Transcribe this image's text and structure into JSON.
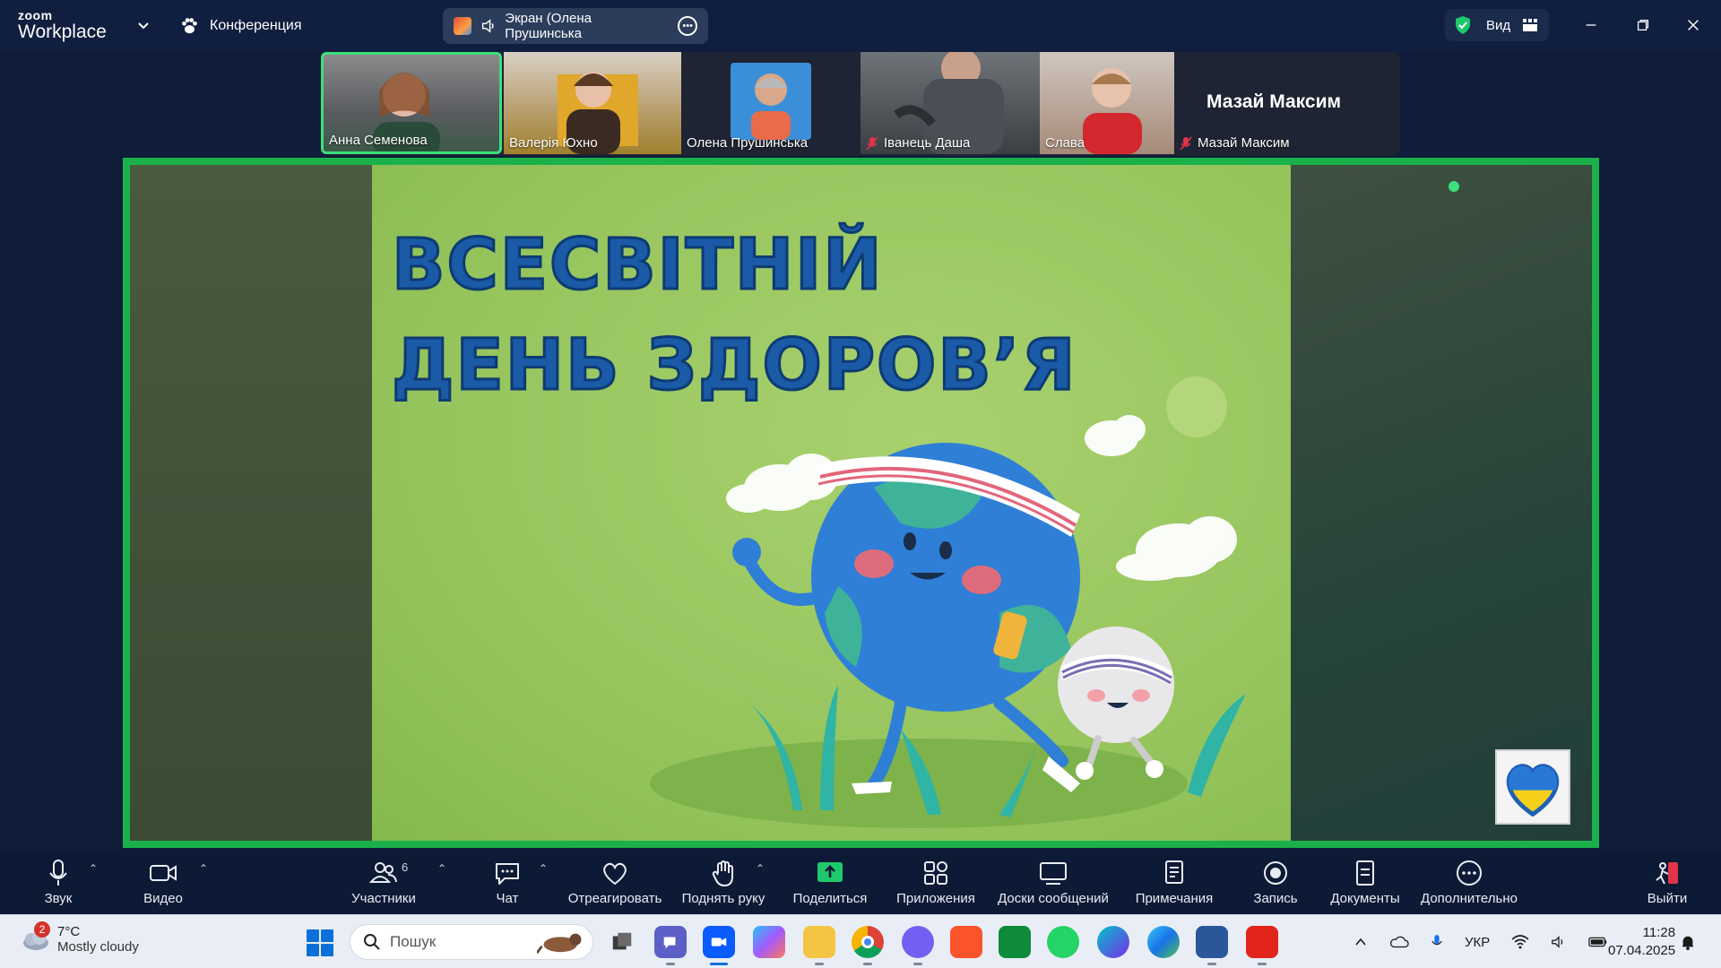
{
  "titlebar": {
    "logo_line1": "zoom",
    "logo_line2": "Workplace",
    "meeting_label": "Конференция",
    "share_label": "Экран (Олена Прушинська",
    "view_label": "Вид"
  },
  "participants": [
    {
      "name": "Анна Семенова",
      "muted": false,
      "active": true
    },
    {
      "name": "Валерія Юхно",
      "muted": false,
      "active": false
    },
    {
      "name": "Олена Прушинська",
      "muted": false,
      "active": false
    },
    {
      "name": "Іванець Даша",
      "muted": true,
      "active": false
    },
    {
      "name": "Слава",
      "muted": false,
      "active": false
    },
    {
      "name": "Мазай Максим",
      "muted": true,
      "active": false,
      "avatar_text": "Мазай Максим"
    }
  ],
  "slide": {
    "title_line1": "ВСЕСВІТНІЙ",
    "title_line2": "ДЕНЬ ЗДОРОВ’Я"
  },
  "toolbar": {
    "audio": "Звук",
    "video": "Видео",
    "participants": "Участники",
    "participants_count": "6",
    "chat": "Чат",
    "react": "Отреагировать",
    "raise_hand": "Поднять руку",
    "share": "Поделиться",
    "apps": "Приложения",
    "whiteboards": "Доски сообщений",
    "notes": "Примечания",
    "record": "Запись",
    "docs": "Документы",
    "more": "Дополнительно",
    "leave": "Выйти"
  },
  "taskbar": {
    "weather_badge": "2",
    "temperature": "7°C",
    "condition": "Mostly cloudy",
    "search_placeholder": "Пошук",
    "language": "УКР",
    "time": "11:28",
    "date": "07.04.2025"
  },
  "colors": {
    "share_border": "#1bb14a",
    "active_speaker": "#3be07a",
    "toolbar_bg": "#0d1a36",
    "share_icon": "#1ec96b",
    "leave_icon": "#e2334b"
  }
}
